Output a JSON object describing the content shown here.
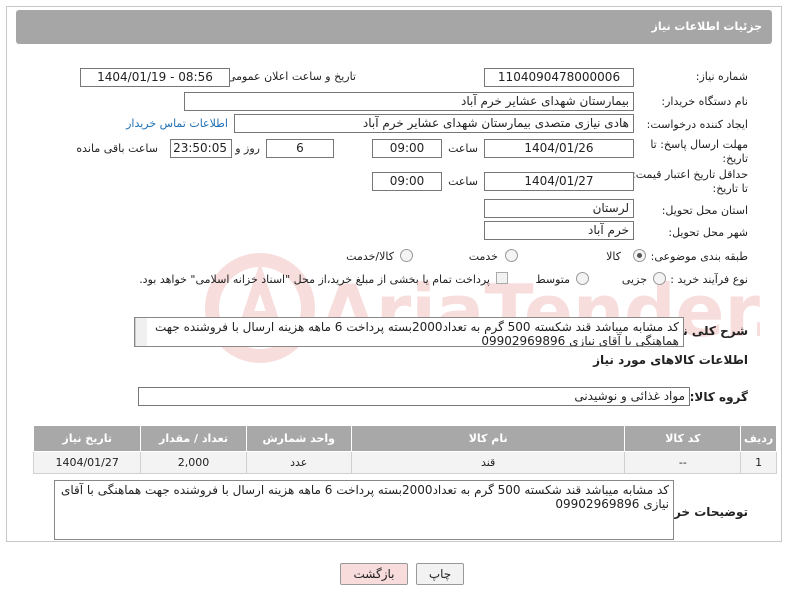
{
  "header": {
    "title": "جزئیات اطلاعات نیاز"
  },
  "form": {
    "need_number_label": "شماره نیاز:",
    "need_number": "1104090478000006",
    "announce_label": "تاریخ و ساعت اعلان عمومی:",
    "announce_value": "1404/01/19 - 08:56",
    "buyer_org_label": "نام دستگاه خریدار:",
    "buyer_org": "بیمارستان شهدای عشایر خرم آباد",
    "requester_label": "ایجاد کننده درخواست:",
    "requester": "هادی نیازی متصدی بیمارستان شهدای عشایر خرم آباد",
    "buyer_contact_link": "اطلاعات تماس خریدار",
    "deadline_label_1": "مهلت ارسال پاسخ: تا",
    "deadline_label_2": "تاریخ:",
    "deadline_date": "1404/01/26",
    "time_label": "ساعت",
    "deadline_time": "09:00",
    "days_value": "6",
    "day_and_label": "روز و",
    "remaining_time": "23:50:05",
    "remaining_label": "ساعت باقی مانده",
    "min_price_label_1": "حداقل تاریخ اعتبار قیمت:",
    "min_price_label_2": "تا تاریخ:",
    "price_date": "1404/01/27",
    "price_time": "09:00",
    "province_label": "استان محل تحویل:",
    "province": "لرستان",
    "city_label": "شهر محل تحویل:",
    "city": "خرم آباد",
    "category_label": "طبقه بندی موضوعی:",
    "category_options": [
      "کالا",
      "خدمت",
      "کالا/خدمت"
    ],
    "category_selected": "کالا",
    "process_label": "نوع فرآیند خرید :",
    "process_options": [
      "جزیی",
      "متوسط"
    ],
    "process_selected": "متوسط",
    "payment_note": "پرداخت تمام یا بخشی از مبلغ خرید،از محل \"اسناد خزانه اسلامی\" خواهد بود.",
    "summary_label": "شرح کلی نیاز:",
    "summary_text": "کد مشابه میباشد قند شکسته 500 گرم به تعداد2000بسته   پرداخت 6 ماهه هزینه ارسال با فروشنده جهت هماهنگی با آقای نیازی 09902969896"
  },
  "goods": {
    "section_title": "اطلاعات کالاهای مورد نیاز",
    "group_label": "گروه کالا:",
    "group_value": "مواد غذائی و نوشیدنی",
    "columns": [
      "ردیف",
      "کد کالا",
      "نام کالا",
      "واحد شمارش",
      "تعداد / مقدار",
      "تاریخ نیاز"
    ],
    "rows": [
      {
        "row": "1",
        "code": "--",
        "name": "قند",
        "unit": "عدد",
        "qty": "2,000",
        "date": "1404/01/27"
      }
    ],
    "buyer_notes_label": "توضیحات خریدار:",
    "buyer_notes": "کد مشابه میباشد قند شکسته 500 گرم به تعداد2000بسته   پرداخت 6 ماهه هزینه ارسال با فروشنده جهت هماهنگی با آقای نیازی 09902969896"
  },
  "buttons": {
    "print": "چاپ",
    "back": "بازگشت"
  },
  "colors": {
    "header_bg": "#a6a6a6",
    "link": "#1f6fb5",
    "back_btn_bg": "#f8dcdc"
  }
}
